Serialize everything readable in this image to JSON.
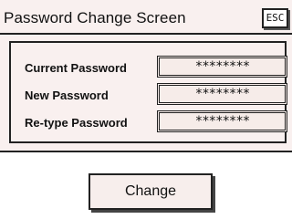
{
  "header": {
    "title": "Password Change Screen",
    "esc_label": "ESC"
  },
  "form": {
    "fields": [
      {
        "label": "Current Password",
        "value": "********"
      },
      {
        "label": "New Password",
        "value": "********"
      },
      {
        "label": "Re-type Password",
        "value": "********"
      }
    ]
  },
  "actions": {
    "change_label": "Change"
  },
  "colors": {
    "background": "#f9f0ef",
    "border": "#222222"
  }
}
